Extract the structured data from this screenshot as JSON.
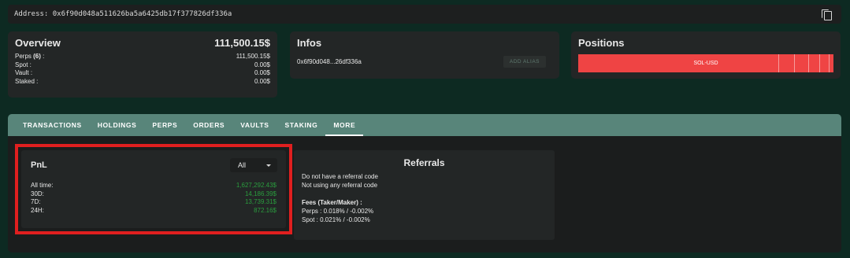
{
  "address_bar": {
    "text": "Address: 0x6f90d048a511626ba5a6425db17f377826df336a",
    "copy_icon": "copy-icon"
  },
  "overview": {
    "title": "Overview",
    "total": "111,500.15$",
    "rows": [
      {
        "label": "Perps",
        "count": "(6)",
        "suffix": " :",
        "value": "111,500.15$"
      },
      {
        "label": "Spot :",
        "value": "0.00$"
      },
      {
        "label": "Vault :",
        "value": "0.00$"
      },
      {
        "label": "Staked :",
        "value": "0.00$"
      }
    ]
  },
  "infos": {
    "title": "Infos",
    "short_address": "0x6f90d048...26df336a",
    "add_alias_label": "ADD ALIAS"
  },
  "positions": {
    "title": "Positions",
    "bar_label": "SOL-USD",
    "bar_color": "#ef4444"
  },
  "tabs": [
    {
      "label": "TRANSACTIONS",
      "active": false
    },
    {
      "label": "HOLDINGS",
      "active": false
    },
    {
      "label": "PERPS",
      "active": false
    },
    {
      "label": "ORDERS",
      "active": false
    },
    {
      "label": "VAULTS",
      "active": false
    },
    {
      "label": "STAKING",
      "active": false
    },
    {
      "label": "MORE",
      "active": true
    }
  ],
  "pnl": {
    "title": "PnL",
    "range_selected": "All",
    "rows": [
      {
        "label": "All time:",
        "value": "1,627,292.43$"
      },
      {
        "label": "30D:",
        "value": "14,186.39$"
      },
      {
        "label": "7D:",
        "value": "13,739.31$"
      },
      {
        "label": "24H:",
        "value": "872.16$"
      }
    ],
    "value_color": "#2a9d3e",
    "highlight_color": "#e01f1f"
  },
  "referrals": {
    "title": "Referrals",
    "line1": "Do not have a referral code",
    "line2": "Not using any referral code",
    "fees_title": "Fees (Taker/Maker) :",
    "perps_fees": "Perps :  0.018% / -0.002%",
    "spot_fees": "Spot :   0.021% / -0.002%"
  }
}
